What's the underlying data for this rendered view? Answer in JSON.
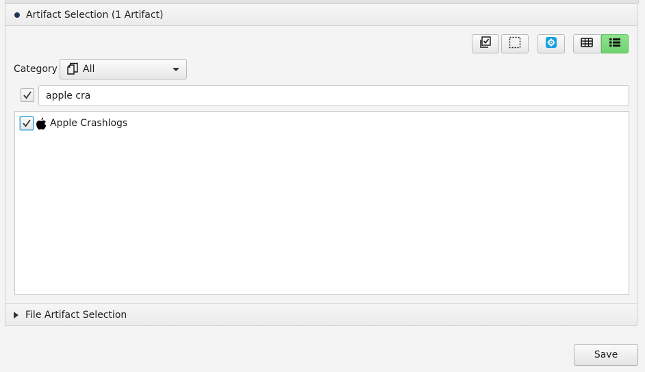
{
  "sections": {
    "artifact_header": "Artifact Selection (1 Artifact)",
    "file_header": "File Artifact Selection"
  },
  "toolbar": {
    "check_all_icon": "check-all-icon",
    "uncheck_all_icon": "uncheck-all-icon",
    "settings_icon": "settings-icon",
    "table_view_icon": "table-view-icon",
    "list_view_icon": "list-view-icon",
    "active_view": "list",
    "active_color": "#7ed87e",
    "settings_color": "#1ba1e2"
  },
  "category": {
    "label": "Category",
    "selected": "All"
  },
  "search": {
    "value": "apple cra",
    "filter_checked": true
  },
  "list": {
    "items": [
      {
        "label": "Apple Crashlogs",
        "checked": true,
        "icon": "apple-icon"
      }
    ]
  },
  "footer": {
    "save_label": "Save"
  }
}
